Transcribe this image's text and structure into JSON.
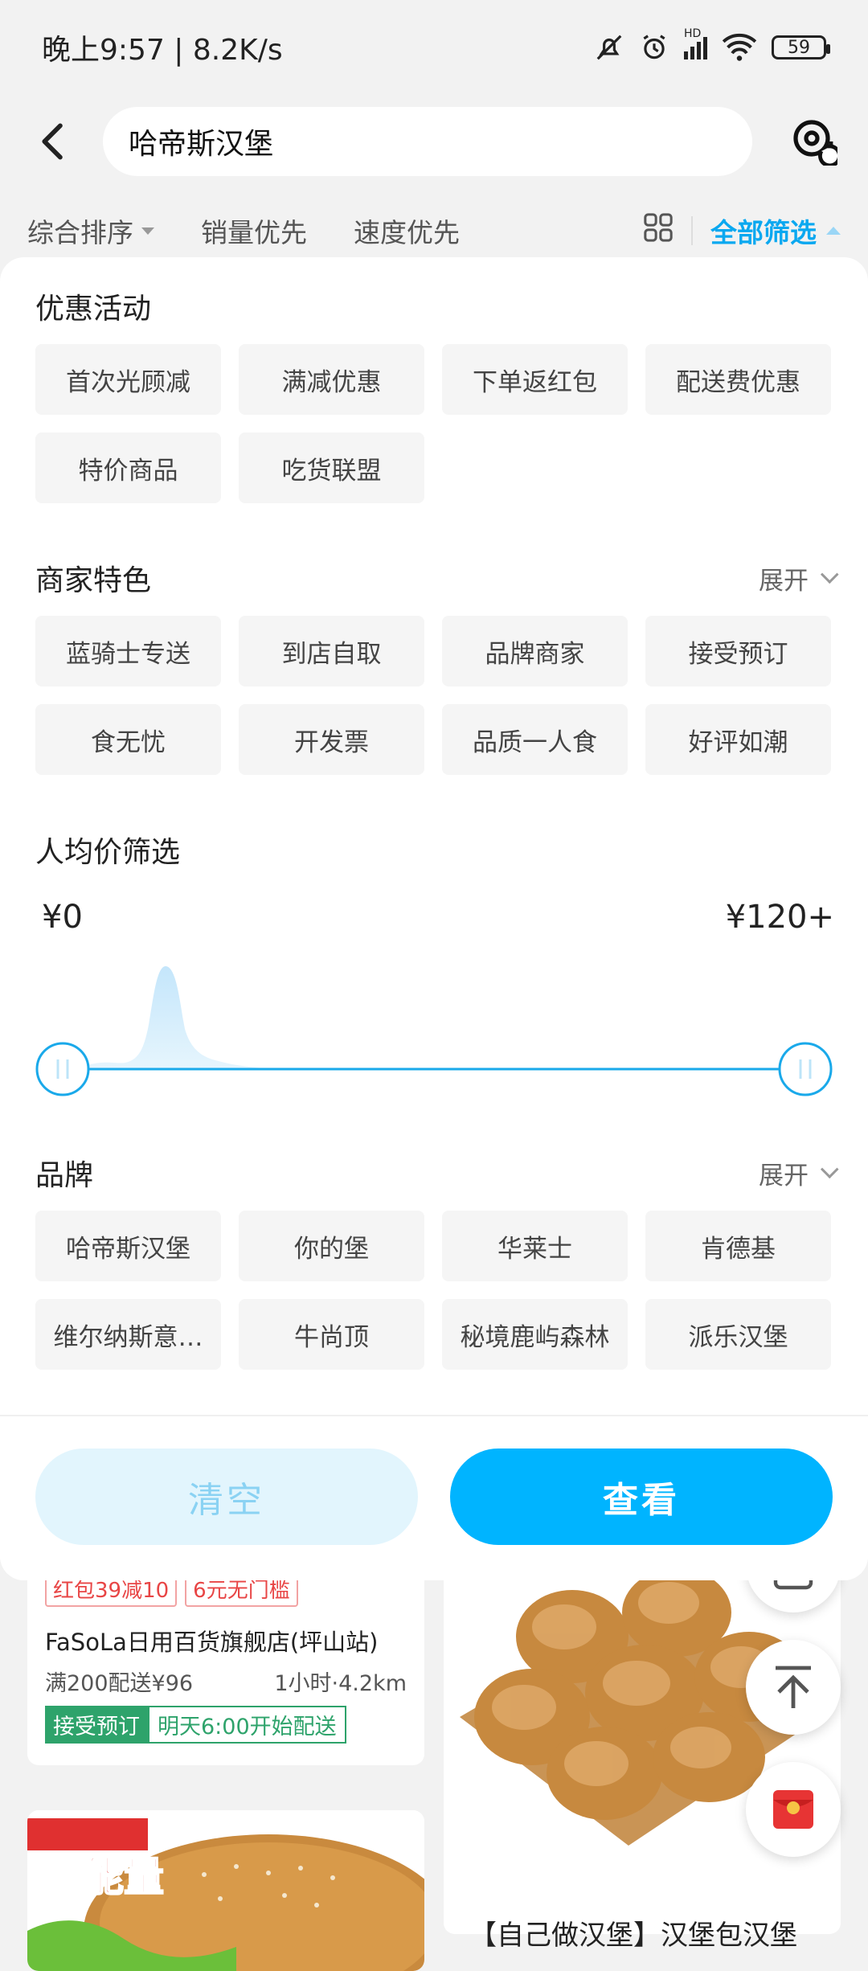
{
  "status": {
    "time_speed": "晚上9:57 | 8.2K/s",
    "battery": "59",
    "signal_label": "HD"
  },
  "header": {
    "search_value": "哈帝斯汉堡"
  },
  "sort_bar": {
    "items": [
      "综合排序",
      "销量优先",
      "速度优先"
    ],
    "filter_all": "全部筛选"
  },
  "filters": {
    "promotions": {
      "title": "优惠活动",
      "tags": [
        "首次光顾减",
        "满减优惠",
        "下单返红包",
        "配送费优惠",
        "特价商品",
        "吃货联盟"
      ]
    },
    "merchant": {
      "title": "商家特色",
      "expand": "展开",
      "tags": [
        "蓝骑士专送",
        "到店自取",
        "品牌商家",
        "接受预订",
        "食无忧",
        "开发票",
        "品质一人食",
        "好评如潮"
      ]
    },
    "price": {
      "title": "人均价筛选",
      "min_label": "¥0",
      "max_label": "¥120+",
      "range": [
        0,
        120
      ]
    },
    "brand": {
      "title": "品牌",
      "expand": "展开",
      "tags": [
        "哈帝斯汉堡",
        "你的堡",
        "华莱士",
        "肯德基",
        "维尔纳斯意…",
        "牛尚顶",
        "秘境鹿屿森林",
        "派乐汉堡"
      ]
    }
  },
  "actions": {
    "clear": "清空",
    "view": "查看"
  },
  "background": {
    "store": {
      "badges": [
        "红包39减10",
        "6元无门槛"
      ],
      "name": "FaSoLa日用百货旗舰店(坪山站)",
      "delivery": "满200配送¥96",
      "eta": "1小时·4.2km",
      "tag_green": "接受预订",
      "tag_outline": "明天6:00开始配送"
    },
    "banner_text": "能量",
    "right_caption": "【自己做汉堡】汉堡包汉堡"
  },
  "colors": {
    "accent": "#00b4ff",
    "green": "#2ea36b",
    "red": "#e84545"
  }
}
